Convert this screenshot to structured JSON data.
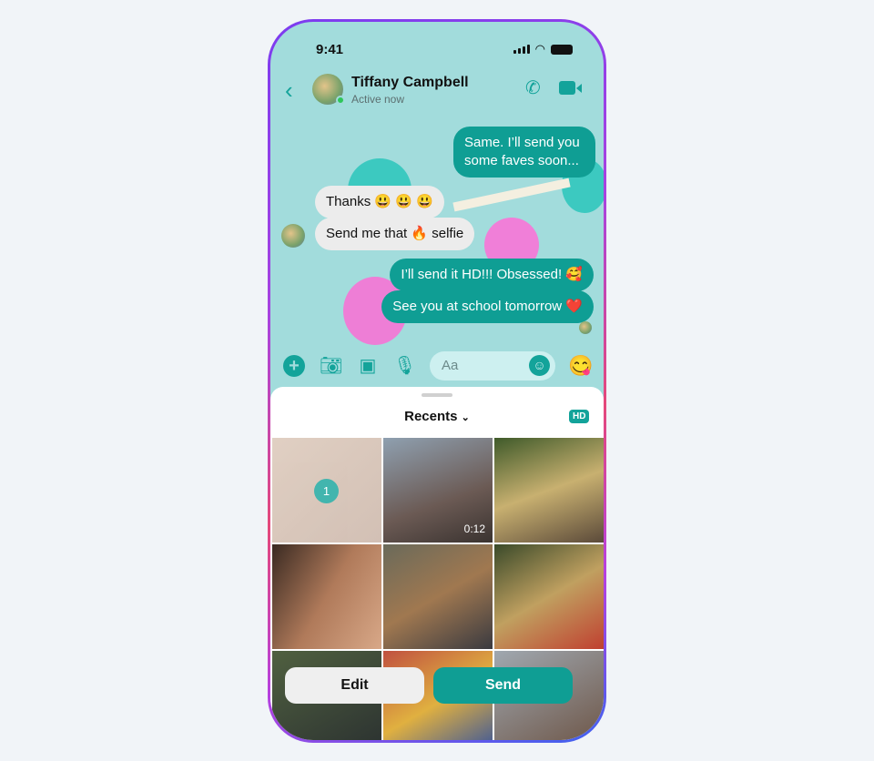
{
  "status": {
    "time": "9:41"
  },
  "header": {
    "contact_name": "Tiffany Campbell",
    "status": "Active now"
  },
  "messages": [
    {
      "dir": "out",
      "text": "Same. I’ll send you some faves soon..."
    },
    {
      "dir": "in",
      "text": "Thanks 😃 😃 😃"
    },
    {
      "dir": "in",
      "text": "Send me that 🔥 selfie"
    },
    {
      "dir": "out",
      "text": "I’ll send it HD!!! Obsessed! 🥰"
    },
    {
      "dir": "out",
      "text": "See you at school tomorrow ❤️"
    }
  ],
  "composer": {
    "placeholder": "Aa",
    "quick_reaction": "😋"
  },
  "sheet": {
    "album": "Recents",
    "hd_badge": "HD",
    "selected_count": "1",
    "video_duration": "0:12"
  },
  "actions": {
    "edit": "Edit",
    "send": "Send"
  },
  "colors": {
    "accent": "#13a39a",
    "chat_bg": "#a2dcdc"
  }
}
